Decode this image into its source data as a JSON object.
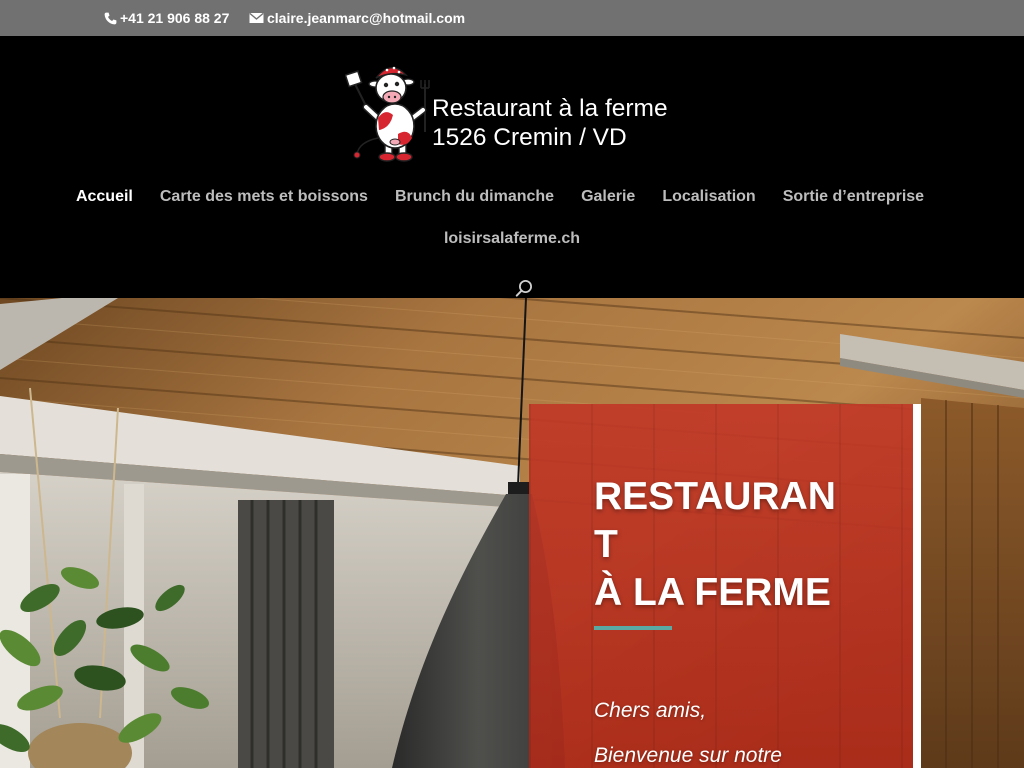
{
  "top_bar": {
    "phone_icon": "phone-icon",
    "phone": "+41 21 906 88 27",
    "email_icon": "envelope-icon",
    "email": "claire.jeanmarc@hotmail.com"
  },
  "logo": {
    "line1": "Restaurant à la ferme",
    "line2": "1526 Cremin / VD"
  },
  "nav": {
    "items": [
      {
        "label": "Accueil",
        "active": true
      },
      {
        "label": "Carte des mets et boissons",
        "active": false
      },
      {
        "label": "Brunch du dimanche",
        "active": false
      },
      {
        "label": "Galerie",
        "active": false
      },
      {
        "label": "Localisation",
        "active": false
      },
      {
        "label": "Sortie d’entreprise",
        "active": false
      },
      {
        "label": "loisirsalaferme.ch",
        "active": false
      }
    ],
    "search_icon": "search-icon"
  },
  "hero": {
    "title_line1": "RESTAURANT",
    "title_line2": "À LA FERME",
    "greeting": "Chers amis,",
    "intro": "Bienvenue sur notre"
  },
  "colors": {
    "top_bar_bg": "#717171",
    "header_bg": "#000000",
    "nav_text": "#bdbdbd",
    "nav_active": "#ffffff",
    "card_red": "#bd2e1b",
    "accent_teal": "#5aa9a3"
  }
}
